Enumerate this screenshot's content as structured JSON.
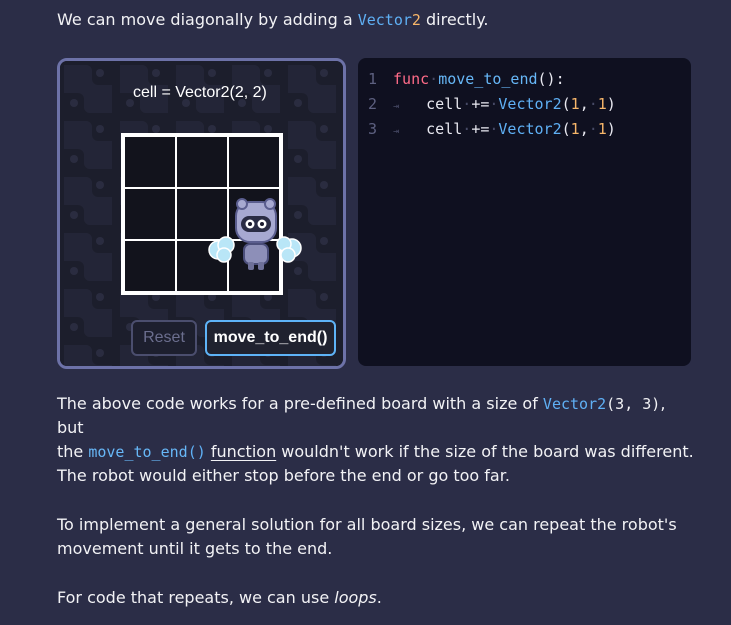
{
  "intro": {
    "before": "We can move diagonally by adding a ",
    "type": "Vector",
    "num": "2",
    "after": " directly."
  },
  "game": {
    "cell_label": "cell = Vector2(2, 2)",
    "reset_label": "Reset",
    "run_label": "move_to_end()"
  },
  "code": {
    "lines": [
      {
        "n": "1",
        "kw": "func",
        "name": "move_to_end",
        "rest": "():"
      },
      {
        "n": "2",
        "lhs": "cell",
        "op": "+=",
        "type": "Vector2",
        "a": "1",
        "b": "1"
      },
      {
        "n": "3",
        "lhs": "cell",
        "op": "+=",
        "type": "Vector2",
        "a": "1",
        "b": "1"
      }
    ]
  },
  "para1": {
    "t1": "The above code works for a pre-defined board with a size of ",
    "code_type": "Vector2",
    "code_args": "(3, 3)",
    "t2": ", but",
    "t3": "the ",
    "fn_name": "move_to_end",
    "fn_parens": "()",
    "link": "function",
    "t4": " wouldn't work if the size of the board was different."
  },
  "para2": "The robot would either stop before the end or go too far.",
  "para3": {
    "l1": "To implement a general solution for all board sizes, we can repeat the robot's",
    "l2": "movement until it gets to the end."
  },
  "para4": {
    "t1": "For code that repeats, we can use ",
    "em": "loops",
    "t2": "."
  },
  "colors": {
    "background": "#2b2d47",
    "accent": "#5eb3f7",
    "keyword": "#ff6b88",
    "number": "#f7b66a",
    "panel_border": "#6d72a8"
  },
  "icons": [
    "robot-icon",
    "tab-marker-icon"
  ]
}
